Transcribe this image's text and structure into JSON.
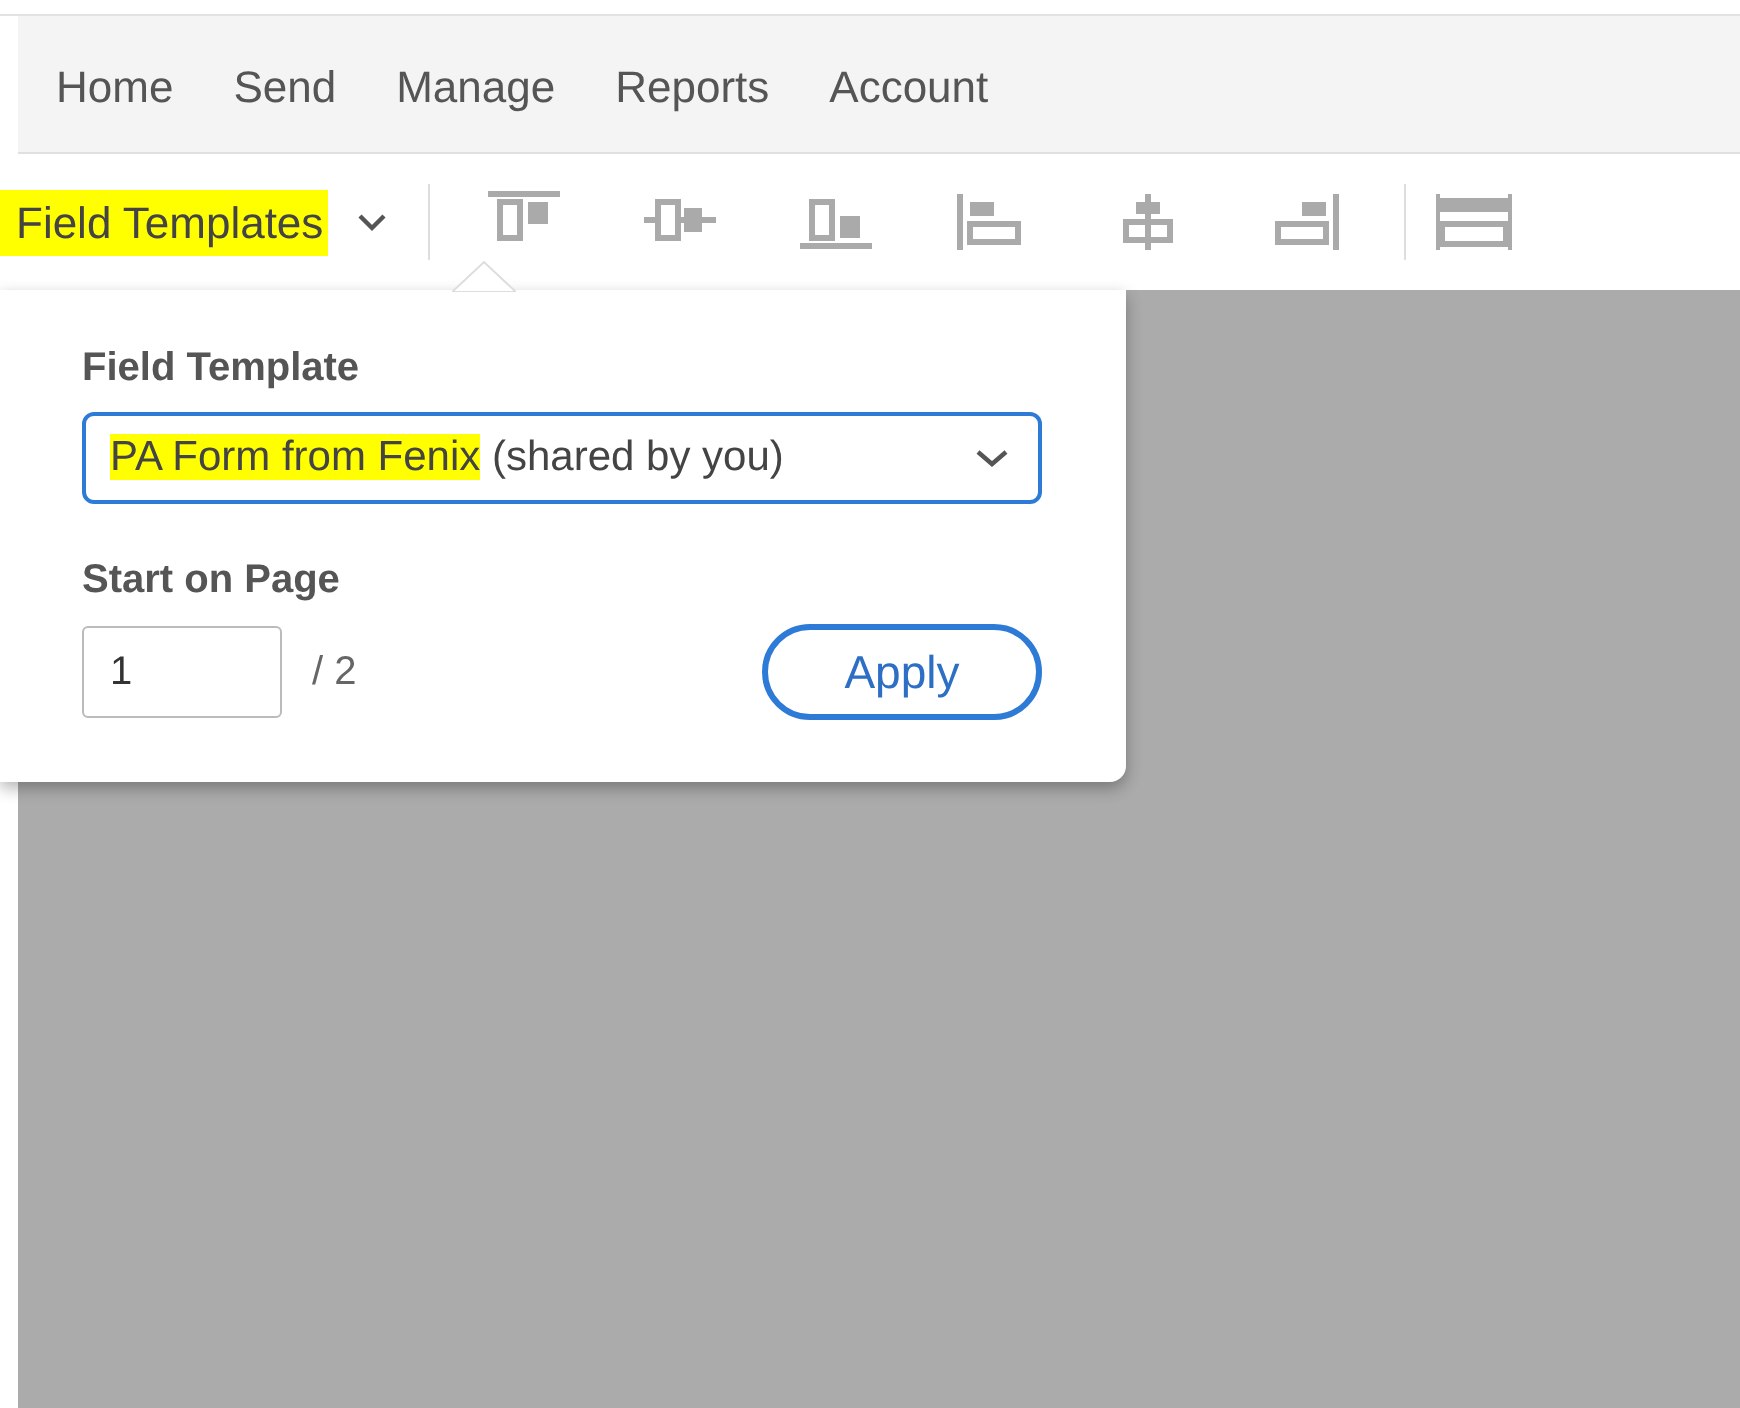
{
  "nav": {
    "items": [
      {
        "label": "Home",
        "selected": false
      },
      {
        "label": "Send",
        "selected": false
      },
      {
        "label": "Manage",
        "selected": false
      },
      {
        "label": "Reports",
        "selected": false
      },
      {
        "label": "Account",
        "selected": false
      }
    ]
  },
  "toolbar": {
    "menu": {
      "label": "Field Templates",
      "highlighted": true,
      "expanded": true
    },
    "tools": [
      {
        "kind": "align-top"
      },
      {
        "kind": "align-middle"
      },
      {
        "kind": "align-bottom"
      },
      {
        "kind": "align-left"
      },
      {
        "kind": "align-center"
      },
      {
        "kind": "align-right"
      },
      {
        "kind": "distribute"
      }
    ]
  },
  "popover": {
    "template_label": "Field Template",
    "template_value": [
      {
        "text": "PA Form from Fenix",
        "highlighted": true
      },
      {
        "text": " (shared by you)",
        "highlighted": false
      }
    ],
    "page_label": "Start on Page",
    "page_value": "1",
    "page_total": "/ 2",
    "apply": "Apply"
  }
}
